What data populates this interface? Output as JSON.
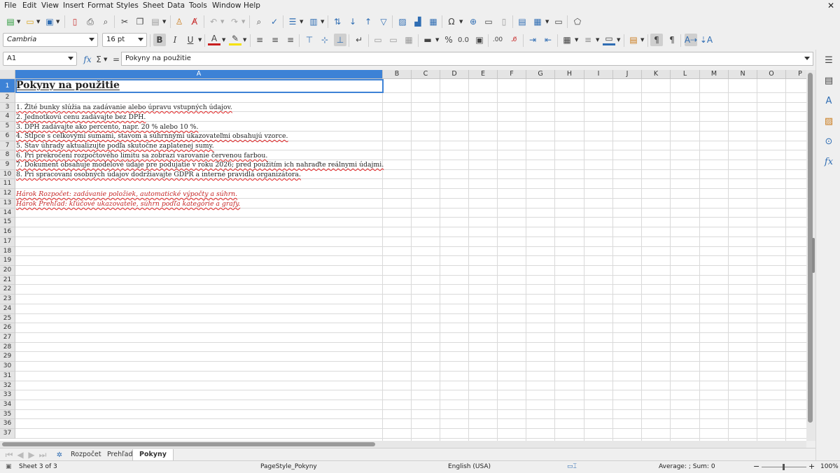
{
  "menu": [
    "File",
    "Edit",
    "View",
    "Insert",
    "Format",
    "Styles",
    "Sheet",
    "Data",
    "Tools",
    "Window",
    "Help"
  ],
  "toolbar2": {
    "font_name": "Cambria",
    "font_size": "16 pt"
  },
  "formula_bar": {
    "cell_ref": "A1",
    "content": "Pokyny na použitie"
  },
  "columns": [
    "A",
    "B",
    "C",
    "D",
    "E",
    "F",
    "G",
    "H",
    "I",
    "J",
    "K",
    "L",
    "M",
    "N",
    "O",
    "P"
  ],
  "rows": [
    "1",
    "2",
    "3",
    "4",
    "5",
    "6",
    "7",
    "8",
    "9",
    "10",
    "11",
    "12",
    "13",
    "14",
    "15",
    "16",
    "17",
    "18",
    "19",
    "20",
    "21",
    "22",
    "23",
    "24",
    "25",
    "26",
    "27",
    "28",
    "29",
    "30",
    "31",
    "32",
    "33",
    "34",
    "35",
    "36",
    "37"
  ],
  "cells": {
    "a1": "Pokyny na použitie",
    "a3": "1. Žlté bunky slúžia na zadávanie alebo úpravu vstupných údajov.",
    "a4": "2. Jednotkovú cenu zadávajte bez DPH.",
    "a5": "3. DPH zadávajte ako percento, napr. 20 % alebo 10 %.",
    "a6": "4. Stĺpce s celkovými sumami, stavom a súhrnnými ukazovateľmi obsahujú vzorce.",
    "a7": "5. Stav úhrady aktualizujte podľa skutočne zaplatenej sumy.",
    "a8": "6. Pri prekročení rozpočtového limitu sa zobrazí varovanie červenou farbou.",
    "a9": "7. Dokument obsahuje modelové údaje pre podujatie v roku 2026; pred použitím ich nahraďte reálnymi údajmi.",
    "a10": "8. Pri spracovaní osobných údajov dodržiavajte GDPR a interné pravidlá organizátora.",
    "a12": "Hárok Rozpočet: zadávanie položiek, automatické výpočty a súhrn.",
    "a13": "Hárok Prehľad: kľúčové ukazovatele, súhrn podľa kategórie a grafy."
  },
  "sheet_tabs": [
    "Rozpočet",
    "Prehľad",
    "Pokyny"
  ],
  "status": {
    "sheet": "Sheet 3 of 3",
    "page_style": "PageStyle_Pokyny",
    "language": "English (USA)",
    "aggregate": "Average: ; Sum: 0",
    "zoom": "100%"
  }
}
